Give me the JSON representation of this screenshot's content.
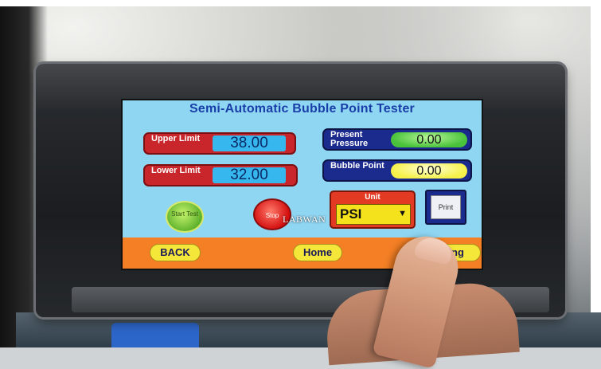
{
  "hmi": {
    "title": "Semi-Automatic Bubble Point Tester",
    "upper_limit": {
      "label": "Upper Limit",
      "value": "38.00"
    },
    "lower_limit": {
      "label": "Lower Limit",
      "value": "32.00"
    },
    "present_pressure": {
      "label": "Present Pressure",
      "value": "0.00"
    },
    "bubble_point": {
      "label": "Bubble Point",
      "value": "0.00"
    },
    "start_button": "Start Test",
    "stop_button": "Stop",
    "unit": {
      "title": "Unit",
      "selected": "PSI"
    },
    "print_button": "Print",
    "footer": {
      "back": "BACK",
      "home": "Home",
      "setting": "ting"
    }
  },
  "watermark": "LABWAN",
  "colors": {
    "screen_bg": "#8fd6f3",
    "limit_red": "#c8262a",
    "pressure_navy": "#1b2a8d",
    "footer_orange": "#f47f24",
    "button_yellow": "#f5e63a"
  }
}
